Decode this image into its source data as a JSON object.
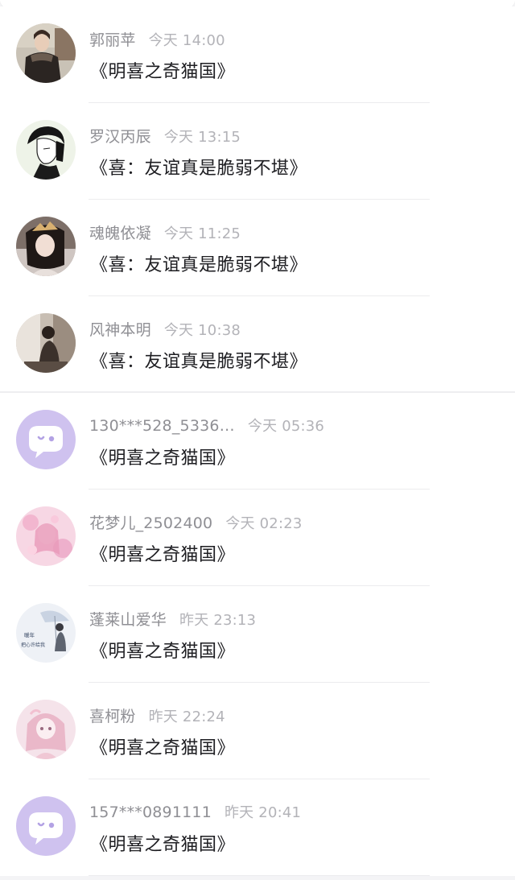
{
  "messages": [
    {
      "name": "郭丽苹",
      "time": "今天 14:00",
      "title": "《明喜之奇猫国》",
      "avatar": "avatar-photo-woman-coat"
    },
    {
      "name": "罗汉丙辰",
      "time": "今天 13:15",
      "title": "《喜：友谊真是脆弱不堪》",
      "avatar": "avatar-illustration-man"
    },
    {
      "name": "魂魄依凝",
      "time": "今天 11:25",
      "title": "《喜：友谊真是脆弱不堪》",
      "avatar": "avatar-photo-woman-crown"
    },
    {
      "name": "风神本明",
      "time": "今天 10:38",
      "title": "《喜：友谊真是脆弱不堪》",
      "avatar": "avatar-photo-woman-seated"
    },
    {
      "name": "130***528_5336…",
      "time": "今天 05:36",
      "title": "《明喜之奇猫国》",
      "avatar": "default-chat-bubble-icon"
    },
    {
      "name": "花梦儿_2502400",
      "time": "今天 02:23",
      "title": "《明喜之奇猫国》",
      "avatar": "avatar-pink-illustration"
    },
    {
      "name": "蓬莱山爱华",
      "time": "昨天 23:13",
      "title": "《明喜之奇猫国》",
      "avatar": "avatar-umbrella-girl",
      "avatar_text": [
        "暖年",
        "把心许给我"
      ]
    },
    {
      "name": "喜柯粉",
      "time": "昨天 22:24",
      "title": "《明喜之奇猫国》",
      "avatar": "avatar-pink-anime-girl"
    },
    {
      "name": "157***0891111",
      "time": "昨天 20:41",
      "title": "《明喜之奇猫国》",
      "avatar": "default-chat-bubble-icon"
    }
  ],
  "colors": {
    "default_avatar_bg": "#cfc2ef",
    "name_text": "#8f8f94",
    "time_text": "#b3b3b8",
    "title_text": "#1e1e22"
  }
}
